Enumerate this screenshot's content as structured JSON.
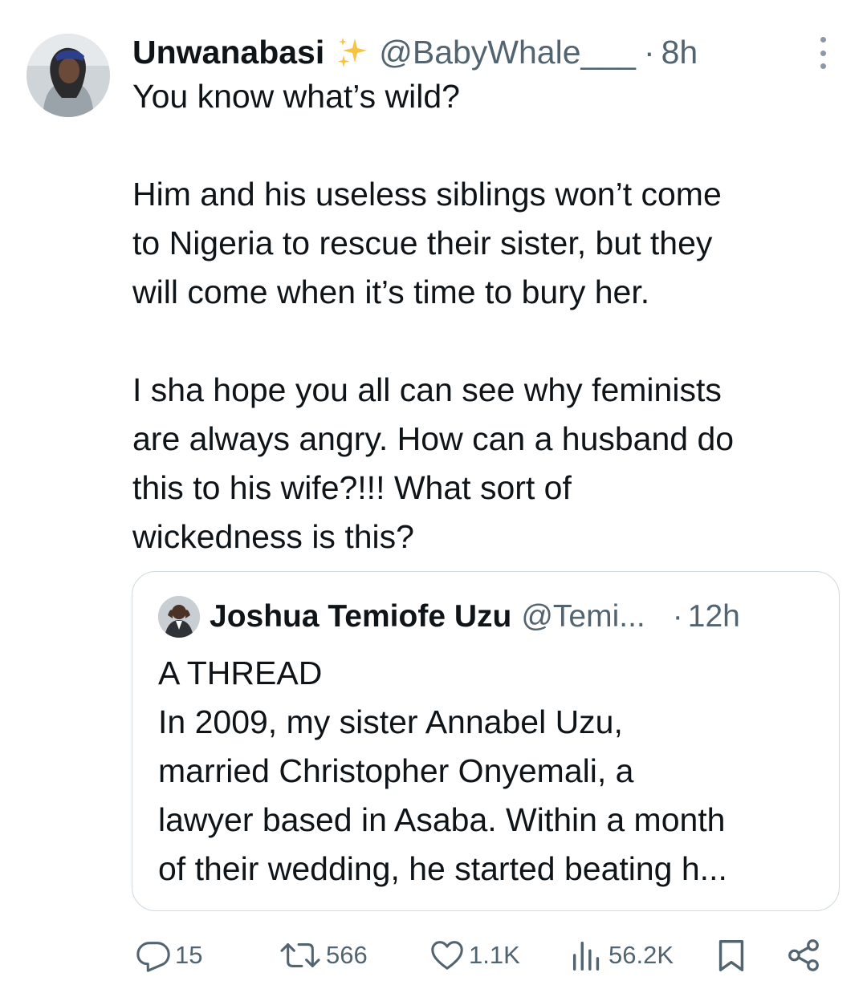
{
  "tweet": {
    "author": {
      "display_name": "Unwanabasi",
      "sparkle": "✨",
      "handle": "@BabyWhale___",
      "separator": "·",
      "time": "8h"
    },
    "text_lines": [
      "You know what’s wild?",
      "",
      "Him and his useless siblings won’t come",
      "to Nigeria to rescue their sister, but they",
      "will come when it’s time to bury her.",
      "",
      "I sha hope you all can see why feminists",
      "are always angry. How can a husband do",
      "this to his wife?!!! What sort of",
      "wickedness is this?"
    ],
    "quoted": {
      "display_name": "Joshua Temiofe Uzu",
      "handle": "@Temi...",
      "separator": "·",
      "time": "12h",
      "text_lines": [
        "A THREAD",
        "In 2009, my sister Annabel Uzu,",
        "married Christopher Onyemali, a",
        "lawyer based in Asaba. Within a month",
        "of their wedding, he started beating h..."
      ]
    },
    "actions": {
      "replies": "15",
      "reposts": "566",
      "likes": "1.1K",
      "views": "56.2K"
    }
  },
  "icons": {
    "reply": "reply-icon",
    "repost": "repost-icon",
    "like": "like-icon",
    "views": "views-icon",
    "bookmark": "bookmark-icon",
    "share": "share-icon",
    "more": "more-icon"
  },
  "colors": {
    "text_primary": "#0f1419",
    "text_secondary": "#536471",
    "border": "#cfd9de"
  }
}
